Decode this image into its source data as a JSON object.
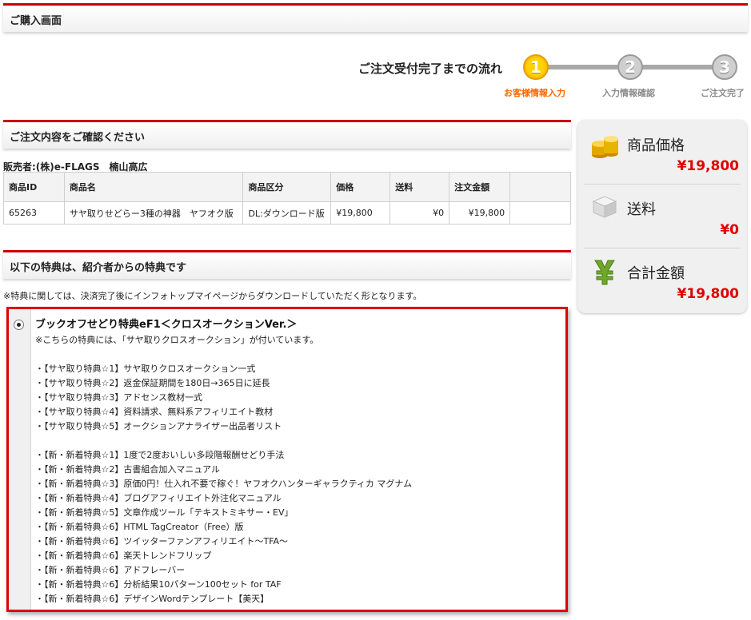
{
  "page": {
    "title": "ご購入画面"
  },
  "flow": {
    "title": "ご注文受付完了までの流れ",
    "steps": [
      {
        "number": "1",
        "label": "お客様情報入力"
      },
      {
        "number": "2",
        "label": "入力情報確認"
      },
      {
        "number": "3",
        "label": "ご注文完了"
      }
    ]
  },
  "order": {
    "heading": "ご注文内容をご確認ください",
    "seller": "販売者:(株)e-FLAGS　楠山高広",
    "columns": [
      "商品ID",
      "商品名",
      "商品区分",
      "価格",
      "送料",
      "注文金額"
    ],
    "rows": [
      {
        "id": "65263",
        "name": "サヤ取りせどらー3種の神器　ヤフオク版",
        "category": "DL:ダウンロード版",
        "price": "¥19,800",
        "shipping": "¥0",
        "total": "¥19,800"
      }
    ]
  },
  "bonus": {
    "heading": "以下の特典は、紹介者からの特典です",
    "note": "※特典に関しては、決済完了後にインフォトップマイページからダウンロードしていただく形となります。",
    "title": "ブックオフせどり特典eF1＜クロスオークションVer.＞",
    "lines": [
      "※こちらの特典には、「サヤ取りクロスオークション」が付いています。",
      "",
      "・【サヤ取り特典☆1】サヤ取りクロスオークション一式",
      "・【サヤ取り特典☆2】返金保証期間を180日→365日に延長",
      "・【サヤ取り特典☆3】アドセンス教材一式",
      "・【サヤ取り特典☆4】資料請求、無料系アフィリエイト教材",
      "・【サヤ取り特典☆5】オークションアナライザー出品者リスト",
      "",
      "・【新・新着特典☆1】1度で2度おいしい多段階報酬せどり手法",
      "・【新・新着特典☆2】古書組合加入マニュアル",
      "・【新・新着特典☆3】原価0円！仕入れ不要で稼ぐ！ヤフオクハンターギャラクティカ マグナム",
      "・【新・新着特典☆4】ブログアフィリエイト外注化マニュアル",
      "・【新・新着特典☆5】文章作成ツール「テキストミキサー・EV」",
      "・【新・新着特典☆6】HTML TagCreator（Free）版",
      "・【新・新着特典☆6】ツイッターファンアフィリエイト～TFA～",
      "・【新・新着特典☆6】楽天トレンドフリップ",
      "・【新・新着特典☆6】アドフレーバー",
      "・【新・新着特典☆6】分析結果10パターン100セット for TAF",
      "・【新・新着特典☆6】デザインWordテンプレート【美天】"
    ]
  },
  "summary": {
    "product_price_label": "商品価格",
    "product_price": "¥19,800",
    "shipping_label": "送料",
    "shipping": "¥0",
    "total_label": "合計金額",
    "total": "¥19,800"
  },
  "colors": {
    "accent": "#cc0000",
    "price": "#e00000",
    "active_step": "#ffd200",
    "active_label": "#ff6600"
  },
  "icons": {
    "price": "coins-icon",
    "shipping": "box-icon",
    "total": "yen-icon"
  }
}
